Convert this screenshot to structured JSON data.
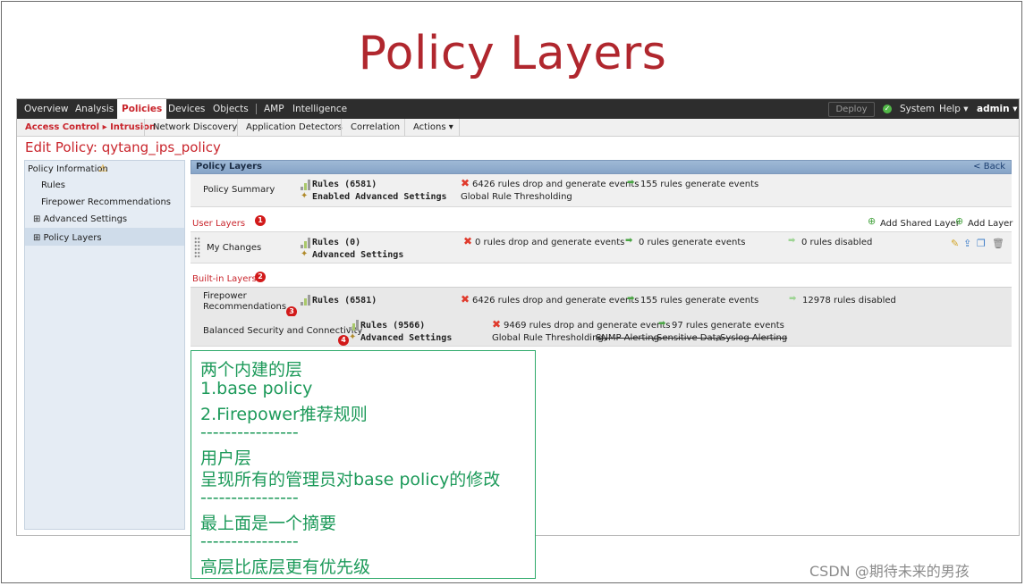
{
  "slide_title": "Policy Layers",
  "topnav": {
    "items": [
      "Overview",
      "Analysis",
      "Policies",
      "Devices",
      "Objects",
      "AMP",
      "Intelligence"
    ],
    "deploy": "Deploy",
    "system": "System",
    "help": "Help ▾",
    "admin": "admin ▾"
  },
  "subnav": {
    "items": [
      "Access Control ▸ Intrusion",
      "Network Discovery",
      "Application Detectors",
      "Correlation",
      "Actions ▾"
    ]
  },
  "edit_title": "Edit Policy: qytang_ips_policy",
  "sidebar": {
    "items": [
      "Policy Information",
      "Rules",
      "Firepower Recommendations",
      "⊞ Advanced Settings",
      "⊞ Policy Layers"
    ]
  },
  "panel": {
    "title": "Policy Layers",
    "back": "< Back",
    "summary": {
      "label": "Policy Summary",
      "rules": "Rules (6581)",
      "adv": "Enabled Advanced Settings",
      "drop": "6426 rules drop and generate events",
      "gen": "155 rules generate events",
      "thresh": "Global Rule Thresholding"
    },
    "user_layers": {
      "heading": "User Layers",
      "badge": "1",
      "add_shared": "Add Shared Layer",
      "add_layer": "Add Layer"
    },
    "my_changes": {
      "label": "My Changes",
      "rules": "Rules (0)",
      "adv": "Advanced Settings",
      "drop": "0 rules drop and generate events",
      "gen": "0 rules generate events",
      "disabled": "0 rules disabled"
    },
    "builtin": {
      "heading": "Built-in Layers",
      "badge": "2"
    },
    "firepower": {
      "label1": "Firepower",
      "label2": "Recommendations",
      "badge": "3",
      "rules": "Rules (6581)",
      "drop": "6426 rules drop and generate events",
      "gen": "155 rules generate events",
      "disabled": "12978 rules disabled"
    },
    "balanced": {
      "label": "Balanced Security and Connectivity",
      "badge": "4",
      "rules": "Rules (9566)",
      "adv": "Advanced Settings",
      "drop": "9469 rules drop and generate events",
      "gen": "97 rules generate events",
      "thresh": "Global Rule Thresholding,",
      "snmp": "SNMP Alerting",
      "sens": "Sensitive Data",
      "syslog": "Syslog Alerting"
    }
  },
  "annotation": {
    "lines": [
      "两个内建的层",
      "1.base policy",
      "2.Firepower推荐规则",
      "----------------",
      "用户层",
      "呈现所有的管理员对base policy的修改",
      "----------------",
      "最上面是一个摘要",
      "----------------",
      "高层比底层更有优先级"
    ]
  },
  "watermark": "CSDN @期待未来的男孩",
  "colors": {
    "accent": "#c9252c",
    "annotation": "#1d9a5a",
    "nav_bg": "#2d2d2d",
    "panel_header": "#9fb9d6"
  }
}
